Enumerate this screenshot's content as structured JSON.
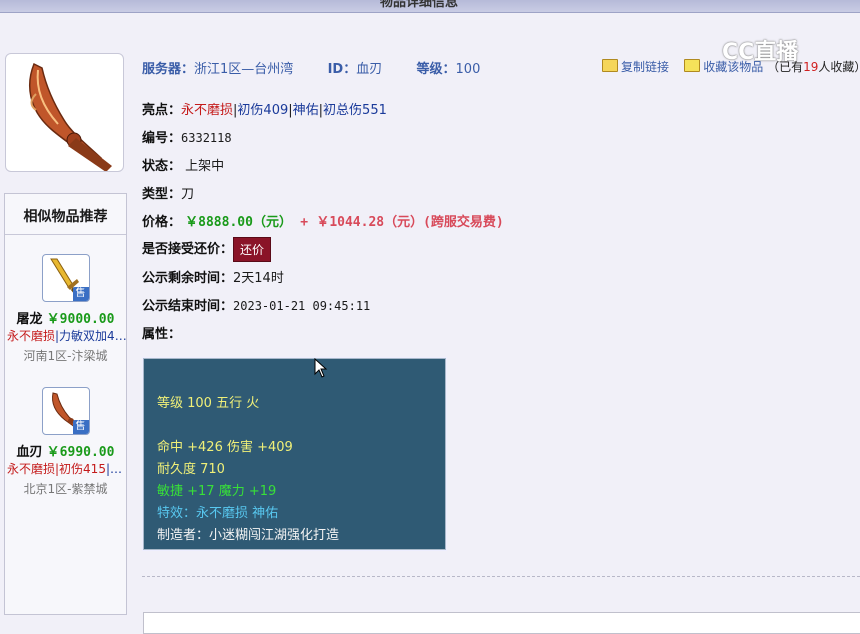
{
  "header": {
    "title": "物品详细信息"
  },
  "watermark": "CC直播",
  "item": {
    "server_label": "服务器：",
    "server": "浙江1区—台州湾",
    "id_label": "ID：",
    "id": "血刃",
    "level_label": "等级：",
    "level": "100",
    "highlights_label": "亮点：",
    "highlights": [
      {
        "text": "永不磨损",
        "color": "#c41a1a"
      },
      {
        "text": "初伤409",
        "color": "#1a3a9a"
      },
      {
        "text": "神佑",
        "color": "#1a3a9a"
      },
      {
        "text": "初总伤551",
        "color": "#1a3a9a"
      }
    ],
    "serial_label": "编号：",
    "serial": "6332118",
    "status_label": "状态：",
    "status": "上架中",
    "type_label": "类型：",
    "type": "刀",
    "price_label": "价格：",
    "price": "￥8888.00（元）",
    "plus": "+",
    "fee": "￥1044.28（元）(跨服交易费)",
    "counter_label": "是否接受还价：",
    "counter_button": "还价",
    "remaining_label": "公示剩余时间：",
    "remaining": "2天14时",
    "end_label": "公示结束时间：",
    "end_time": "2023-01-21 09:45:11",
    "attr_label": "属性："
  },
  "actions": {
    "copy_link": "复制链接",
    "favorite": "收藏该物品",
    "fav_prefix": "（已有",
    "fav_count": "19",
    "fav_suffix": "人收藏）"
  },
  "attributes": [
    {
      "text": "等级 100 五行 火",
      "color": "yellow"
    },
    {
      "text": "命中 +426 伤害 +409",
      "color": "yellow"
    },
    {
      "text": "耐久度 710",
      "color": "yellow"
    },
    {
      "text": "敏捷 +17 魔力 +19",
      "color": "green"
    },
    {
      "text": "特效：永不磨损 神佑",
      "color": "cyan"
    },
    {
      "text": "制造者：小迷糊闯江湖强化打造",
      "color": "white"
    }
  ],
  "sidebar": {
    "title": "相似物品推荐",
    "sell_tag": "售",
    "items": [
      {
        "name": "屠龙",
        "price": "￥9000.00",
        "tag_red": "永不磨损",
        "tag_rest": "|力敏双加4…",
        "server": "河南1区-汴梁城"
      },
      {
        "name": "血刃",
        "price": "￥6990.00",
        "tag_red": "永不磨损|初伤415",
        "tag_rest": "|…",
        "server": "北京1区-紫禁城"
      }
    ]
  }
}
